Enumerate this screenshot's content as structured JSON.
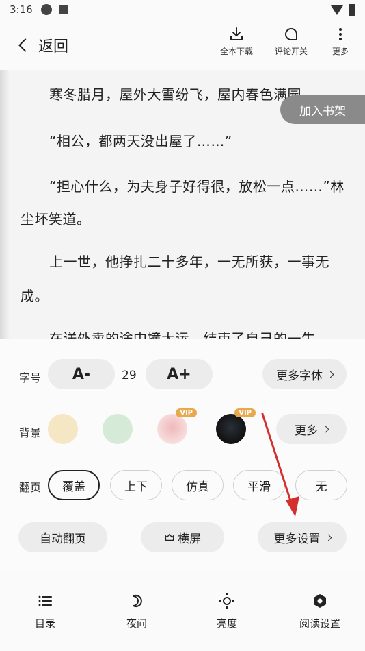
{
  "status_bar": {
    "time": "3:16"
  },
  "header": {
    "back_label": "返回",
    "actions": [
      {
        "label": "全本下载",
        "icon": "download-icon"
      },
      {
        "label": "评论开关",
        "icon": "comment-toggle-icon"
      },
      {
        "label": "更多",
        "icon": "more-vertical-icon"
      }
    ]
  },
  "reader": {
    "paragraphs": [
      "寒冬腊月，屋外大雪纷飞，屋内春色满园。",
      "“相公，都两天没出屋了……”",
      "“担心什么，为夫身子好得很，放松一点……”林",
      "尘坏笑道。",
      "上一世，他挣扎二十多年，一无所获，一事无",
      "成。",
      "在送外卖的途中撞大运，结束了自己的一生。"
    ],
    "add_to_shelf": "加入书架"
  },
  "settings": {
    "font_size": {
      "label": "字号",
      "decrease": "A-",
      "value": "29",
      "increase": "A+",
      "more_fonts": "更多字体"
    },
    "background": {
      "label": "背景",
      "swatches": [
        {
          "color": "#f5e6c4",
          "vip": false
        },
        {
          "color": "#d6ead8",
          "vip": false
        },
        {
          "color": "#f3d6d6",
          "vip": true
        },
        {
          "color": "#1a1a1a",
          "vip": true
        }
      ],
      "vip_text": "VIP",
      "more": "更多"
    },
    "page_turn": {
      "label": "翻页",
      "options": [
        "覆盖",
        "上下",
        "仿真",
        "平滑",
        "无"
      ],
      "selected": "覆盖"
    },
    "buttons": {
      "auto_page": "自动翻页",
      "landscape": "横屏",
      "more_settings": "更多设置"
    }
  },
  "bottom_nav": [
    {
      "label": "目录",
      "icon": "list-icon"
    },
    {
      "label": "夜间",
      "icon": "moon-icon"
    },
    {
      "label": "亮度",
      "icon": "brightness-icon"
    },
    {
      "label": "阅读设置",
      "icon": "settings-hex-icon"
    }
  ],
  "colors": {
    "accent_annotation": "#d32f2f",
    "vip_badge": "#e8a84c"
  }
}
